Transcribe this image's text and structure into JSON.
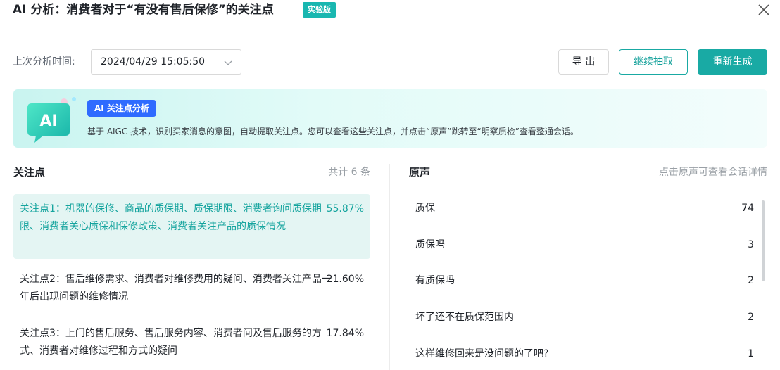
{
  "header": {
    "title": "AI 分析：消费者对于“有没有售后保修”的关注点",
    "badge": "实验版",
    "close_icon": "close-icon"
  },
  "toolbar": {
    "time_label": "上次分析时间:",
    "time_value": "2024/04/29 15:05:50",
    "export_label": "导 出",
    "continue_label": "继续抽取",
    "regenerate_label": "重新生成"
  },
  "banner": {
    "tag": "AI 关注点分析",
    "description": "基于 AIGC 技术，识别买家消息的意图，自动提取关注点。您可以查看这些关注点，并点击“原声”跳转至“明察质检”查看整通会话。",
    "icon_text": "AI"
  },
  "focus": {
    "title": "关注点",
    "total": "共计 6 条",
    "items": [
      {
        "text": "关注点1：机器的保修、商品的质保期、质保期限、消费者询问质保期限、消费者关心质保和保修政策、消费者关注产品的质保情况",
        "percent": "55.87%"
      },
      {
        "text": "关注点2：售后维修需求、消费者对维修费用的疑问、消费者关注产品一年后出现问题的维修情况",
        "percent": "21.60%"
      },
      {
        "text": "关注点3：上门的售后服务、售后服务内容、消费者问及售后服务的方式、消费者对维修过程和方式的疑问",
        "percent": "17.84%"
      }
    ]
  },
  "voice": {
    "title": "原声",
    "hint": "点击原声可查看会话详情",
    "items": [
      {
        "text": "质保",
        "count": "74"
      },
      {
        "text": "质保吗",
        "count": "3"
      },
      {
        "text": "有质保吗",
        "count": "2"
      },
      {
        "text": "坏了还不在质保范围内",
        "count": "2"
      },
      {
        "text": "这样维修回来是没问题的了吧?",
        "count": "1"
      }
    ]
  },
  "colors": {
    "accent": "#19aaa4",
    "active_bg": "#e4f5f3",
    "tag_blue": "#2f6bff"
  }
}
